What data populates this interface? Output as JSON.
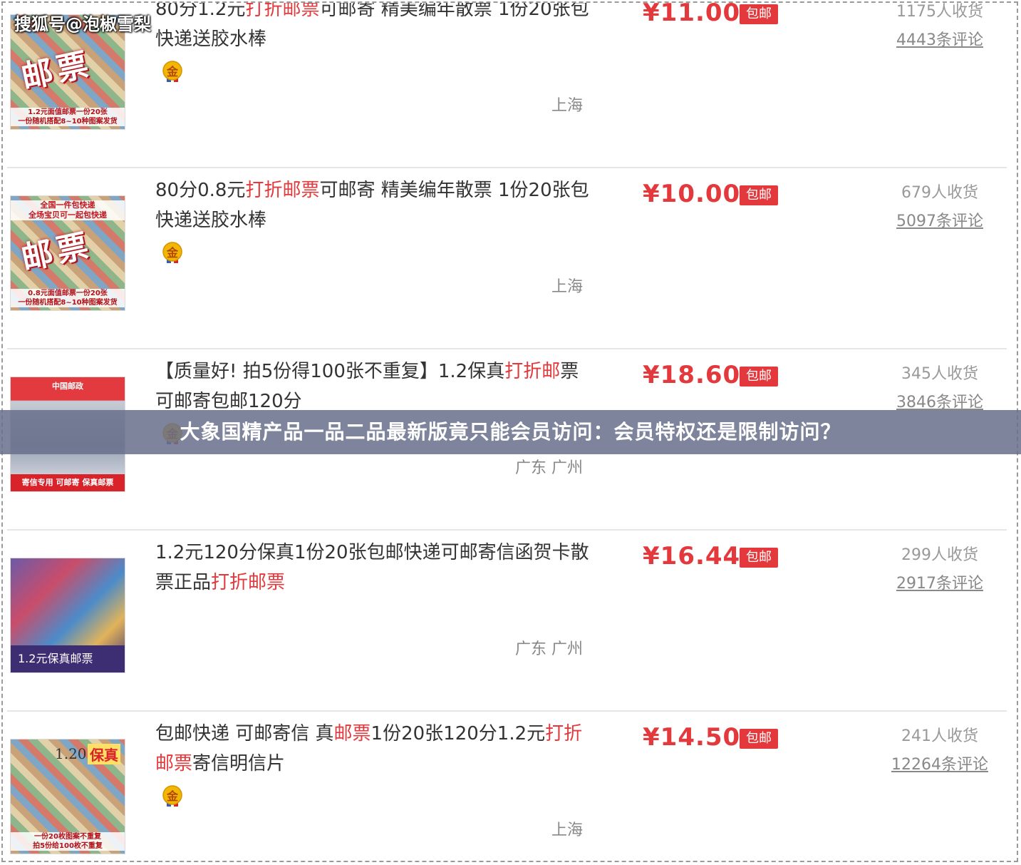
{
  "watermark": "搜狐号@泡椒雪梨",
  "overlay_title": "大象国精产品一品二品最新版竟只能会员访问：会员特权还是限制访问？",
  "shipping_label": "包邮",
  "medal_label": "金",
  "colors": {
    "price": "#e4393c",
    "highlight": "#e4393c",
    "text": "#333333",
    "muted": "#888888",
    "overlay": "#69708c"
  },
  "products": [
    {
      "title_parts": [
        {
          "text": "80分1.2元",
          "hl": false
        },
        {
          "text": "打折邮票",
          "hl": true
        },
        {
          "text": "可邮寄 精美编年散票 1份20张包快递送胶水棒",
          "hl": false
        }
      ],
      "price": "¥11.00",
      "sold": "1175人收货",
      "reviews": "4443条评论",
      "location": "上海",
      "has_medal": true,
      "thumb": {
        "style": "stamps-red",
        "big": "邮票",
        "caption": "1.2元面值邮票一份20张\n一份随机搭配8~10种图案发货"
      }
    },
    {
      "title_parts": [
        {
          "text": "80分0.8元",
          "hl": false
        },
        {
          "text": "打折邮票",
          "hl": true
        },
        {
          "text": "可邮寄 精美编年散票 1份20张包快递送胶水棒",
          "hl": false
        }
      ],
      "price": "¥10.00",
      "sold": "679人收货",
      "reviews": "5097条评论",
      "location": "上海",
      "has_medal": true,
      "thumb": {
        "style": "stamps-red",
        "toptext": "全国一件包快递\n全场宝贝可一起包快递",
        "big": "邮票",
        "caption": "0.8元面值邮票一份20张\n一份随机搭配8~10种图案发货"
      }
    },
    {
      "title_parts": [
        {
          "text": "【质量好! 拍5份得100张不重复】1.2保真",
          "hl": false
        },
        {
          "text": "打折邮",
          "hl": true
        },
        {
          "text": "票可邮寄包邮120分",
          "hl": false
        }
      ],
      "price": "¥18.60",
      "sold": "345人收货",
      "reviews": "3846条评论",
      "location": "广东 广州",
      "has_medal": true,
      "thumb": {
        "style": "china-post",
        "toptext": "中国邮政",
        "caption": "寄信专用 可邮寄 保真邮票"
      }
    },
    {
      "title_parts": [
        {
          "text": "1.2元120分保真1份20张包邮快递可邮寄信函贺卡散票正品",
          "hl": false
        },
        {
          "text": "打折邮票",
          "hl": true
        }
      ],
      "price": "¥16.44",
      "sold": "299人收货",
      "reviews": "2917条评论",
      "location": "广东 广州",
      "has_medal": false,
      "thumb": {
        "style": "purple",
        "caption": "1.2元保真邮票"
      }
    },
    {
      "title_parts": [
        {
          "text": "包邮快递 可邮寄信 真",
          "hl": false
        },
        {
          "text": "邮票",
          "hl": true
        },
        {
          "text": "1份20张120分1.2元",
          "hl": false
        },
        {
          "text": "打折邮票",
          "hl": true
        },
        {
          "text": "寄信明信片",
          "hl": false
        }
      ],
      "price": "¥14.50",
      "sold": "241人收货",
      "reviews": "12264条评论",
      "location": "上海",
      "has_medal": true,
      "thumb": {
        "style": "baozhen",
        "num": "1.20",
        "tag": "保真",
        "caption": "一份20枚图案不重复\n拍5份给100枚不重复"
      }
    }
  ]
}
